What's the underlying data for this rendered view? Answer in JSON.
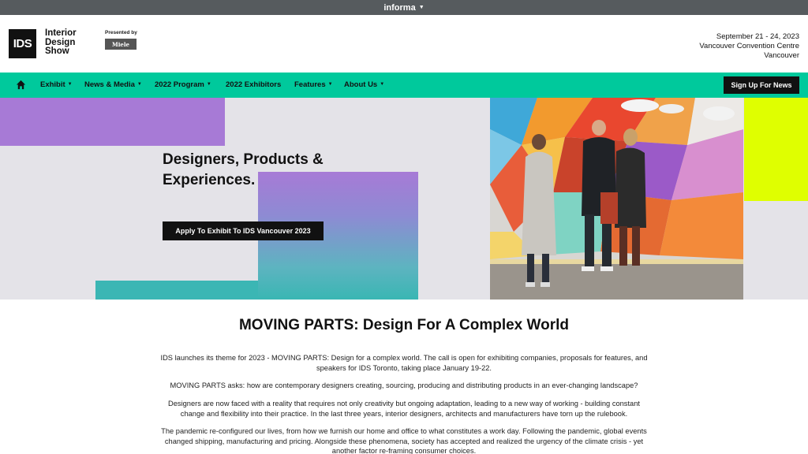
{
  "topbar": {
    "brand": "informa",
    "caret": "▼"
  },
  "header": {
    "logo_mark": "IDS",
    "logo_lines": [
      "Interior",
      "Design",
      "Show"
    ],
    "presented_by": "Presented by",
    "sponsor": "Miele",
    "dates": "September 21 - 24, 2023",
    "venue": "Vancouver Convention Centre",
    "city": "Vancouver"
  },
  "nav": {
    "home_icon": "home-icon",
    "items": [
      {
        "label": "Exhibit",
        "dropdown": "▼"
      },
      {
        "label": "News & Media",
        "dropdown": "▼"
      },
      {
        "label": "2022 Program",
        "dropdown": "▼"
      },
      {
        "label": "2022 Exhibitors"
      },
      {
        "label": "Features",
        "dropdown": "▼"
      },
      {
        "label": "About Us",
        "dropdown": "▼"
      }
    ],
    "signup_label": "Sign Up For News"
  },
  "hero": {
    "title_line1": "Designers, Products &",
    "title_line2": "Experiences.",
    "cta_label": "Apply To Exhibit To IDS Vancouver 2023"
  },
  "content": {
    "heading": "MOVING PARTS: Design For A Complex World",
    "paragraphs": [
      "IDS launches its theme for 2023 - MOVING PARTS: Design for a complex world. The call is open for exhibiting companies, proposals for features, and speakers for IDS Toronto, taking place January 19-22.",
      "MOVING PARTS asks: how are contemporary designers creating, sourcing, producing and distributing products in an ever-changing landscape?",
      "Designers are now faced with a reality that requires not only creativity but ongoing adaptation, leading to a new way of working - building constant change and flexibility into their practice. In the last three years, interior designers, architects and manufacturers have torn up the rulebook.",
      "The pandemic re-configured our lives, from how we furnish our home and office to what constitutes a work day. Following the pandemic, global events changed shipping, manufacturing and pricing. Alongside these phenomena, society has accepted and realized the urgency of the climate crisis - yet another factor re-framing consumer choices."
    ]
  },
  "colors": {
    "nav_green": "#00c99c",
    "purple": "#a77ad6",
    "teal": "#3bb6b4",
    "yellow": "#dfff00",
    "topbar_gray": "#565b5e"
  }
}
